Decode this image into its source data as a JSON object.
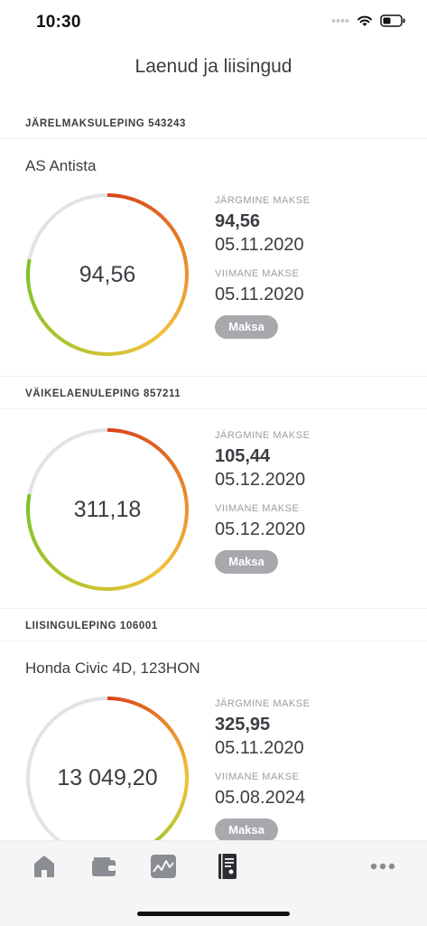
{
  "status_bar": {
    "time": "10:30"
  },
  "page": {
    "title": "Laenud ja liisingud"
  },
  "contracts": [
    {
      "header": "JÄRELMAKSULEPING 543243",
      "title": "AS Antista",
      "ring_value": "94,56",
      "progress_fraction": 0.78,
      "next_label": "JÄRGMINE MAKSE",
      "next_amount": "94,56",
      "next_date": "05.11.2020",
      "last_label": "VIIMANE MAKSE",
      "last_date": "05.11.2020",
      "pay_label": "Maksa"
    },
    {
      "header": "VÄIKELAENULEPING 857211",
      "title": "",
      "ring_value": "311,18",
      "progress_fraction": 0.78,
      "next_label": "JÄRGMINE MAKSE",
      "next_amount": "105,44",
      "next_date": "05.12.2020",
      "last_label": "VIIMANE MAKSE",
      "last_date": "05.12.2020",
      "pay_label": "Maksa"
    },
    {
      "header": "LIISINGULEPING 106001",
      "title": "Honda Civic 4D, 123HON",
      "ring_value": "13 049,20",
      "progress_fraction": 0.5,
      "next_label": "JÄRGMINE MAKSE",
      "next_amount": "325,95",
      "next_date": "05.11.2020",
      "last_label": "VIIMANE MAKSE",
      "last_date": "05.08.2024",
      "pay_label": "Maksa"
    }
  ],
  "tabs": [
    {
      "icon": "home-icon"
    },
    {
      "icon": "wallet-icon"
    },
    {
      "icon": "chart-icon"
    },
    {
      "icon": "contract-book-icon"
    },
    {
      "icon": "more-icon"
    }
  ],
  "colors": {
    "ring_track": "#e3e3e3",
    "ring_start": "#d9441b",
    "ring_mid": "#f3c23a",
    "ring_end": "#78c424",
    "button": "#a7a9ad",
    "tab_icon": "#8a8d92"
  }
}
